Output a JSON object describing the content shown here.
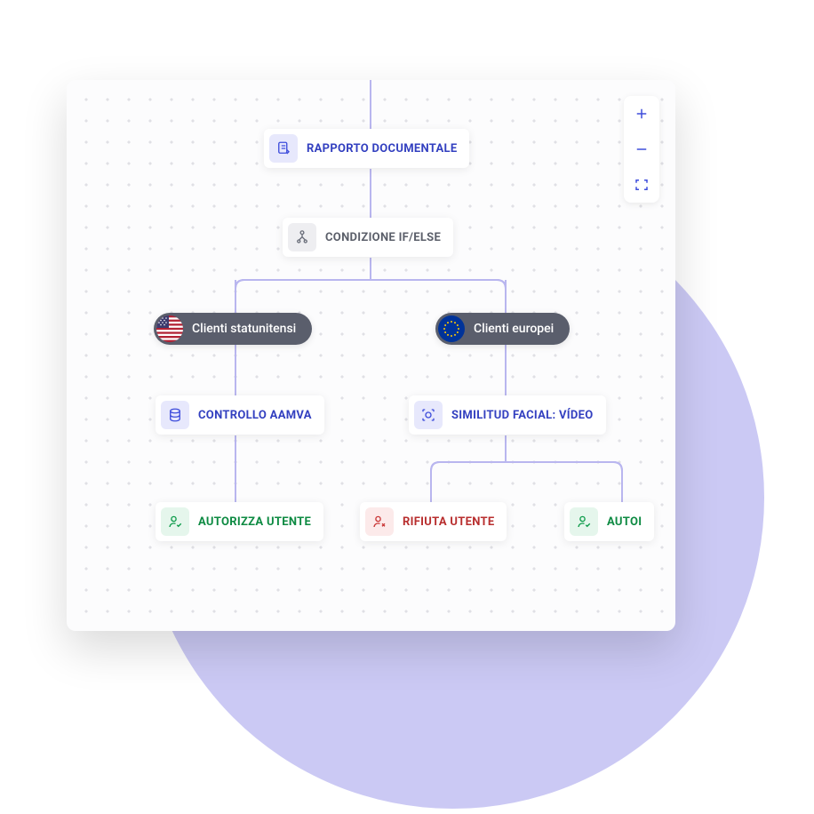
{
  "nodes": {
    "root": {
      "label": "RAPPORTO DOCUMENTALE"
    },
    "condition": {
      "label": "CONDIZIONE IF/ELSE"
    },
    "us_branch": {
      "label": "Clienti statunitensi"
    },
    "eu_branch": {
      "label": "Clienti europei"
    },
    "aamva": {
      "label": "CONTROLLO AAMVA"
    },
    "facial": {
      "label": "SIMILITUD FACIAL: VÍDEO"
    },
    "approve_us": {
      "label": "AUTORIZZA UTENTE"
    },
    "reject_eu": {
      "label": "RIFIUTA UTENTE"
    },
    "approve_eu": {
      "label": "AUTOI"
    }
  },
  "controls": {
    "zoom_in": "+",
    "zoom_out": "−",
    "fullscreen": "⛶"
  }
}
